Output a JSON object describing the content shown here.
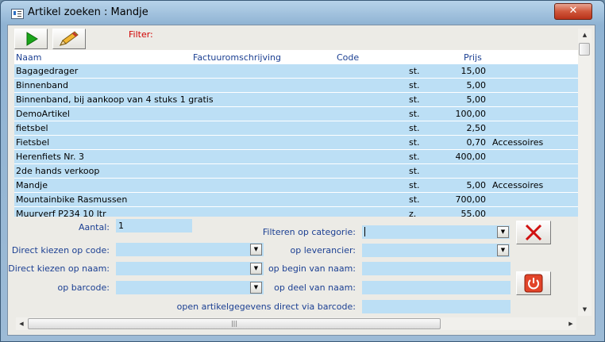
{
  "window": {
    "title": "Artikel zoeken : Mandje",
    "close_glyph": "✕"
  },
  "toolbar": {
    "filter_label": "Filter:"
  },
  "list": {
    "columns": [
      "Naam",
      "Factuuromschrijving",
      "Code",
      "Prijs"
    ],
    "rows": [
      {
        "name": "Bagagedrager",
        "unit": "st.",
        "price": "15,00",
        "category": ""
      },
      {
        "name": "Binnenband",
        "unit": "st.",
        "price": "5,00",
        "category": ""
      },
      {
        "name": "Binnenband, bij aankoop van 4 stuks 1 gratis",
        "unit": "st.",
        "price": "5,00",
        "category": ""
      },
      {
        "name": "DemoArtikel",
        "unit": "st.",
        "price": "100,00",
        "category": ""
      },
      {
        "name": "fietsbel",
        "unit": "st.",
        "price": "2,50",
        "category": ""
      },
      {
        "name": "Fietsbel",
        "unit": "st.",
        "price": "0,70",
        "category": "Accessoires"
      },
      {
        "name": "Herenfiets Nr. 3",
        "unit": "st.",
        "price": "400,00",
        "category": ""
      },
      {
        "name": "2de hands verkoop",
        "unit": "st.",
        "price": "",
        "category": ""
      },
      {
        "name": "Mandje",
        "unit": "st.",
        "price": "5,00",
        "category": "Accessoires"
      },
      {
        "name": "Mountainbike Rasmussen",
        "unit": "st.",
        "price": "700,00",
        "category": ""
      },
      {
        "name": "Muurverf P234 10 ltr",
        "unit": "z.",
        "price": "55,00",
        "category": ""
      }
    ]
  },
  "form": {
    "aantal_label": "Aantal:",
    "aantal_value": "1",
    "code_label": "Direct kiezen op code:",
    "naam_label": "Direct kiezen op naam:",
    "barcode_label": "op barcode:",
    "categorie_label": "Filteren op categorie:",
    "leverancier_label": "op leverancier:",
    "begin_label": "op begin van naam:",
    "deel_label": "op deel van naam:",
    "open_label": "open artikelgegevens direct via barcode:"
  },
  "colors": {
    "row_bg": "#bcdff5",
    "label": "#1b3f92",
    "filter": "#d00000"
  }
}
